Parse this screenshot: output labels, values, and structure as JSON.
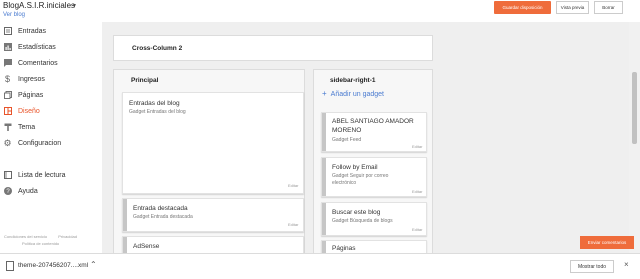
{
  "header": {
    "blog_title": "BlogA.S.I.R.iniciales",
    "view_blog": "Ver blog",
    "save_label": "Guardar disposición",
    "preview_label": "Vista previa",
    "delete_label": "Borrar"
  },
  "sidebar": {
    "items": [
      {
        "label": "Entradas",
        "icon": "posts-icon"
      },
      {
        "label": "Estadísticas",
        "icon": "stats-icon"
      },
      {
        "label": "Comentarios",
        "icon": "comments-icon"
      },
      {
        "label": "Ingresos",
        "icon": "dollar-icon"
      },
      {
        "label": "Páginas",
        "icon": "pages-icon"
      },
      {
        "label": "Diseño",
        "icon": "layout-icon"
      },
      {
        "label": "Tema",
        "icon": "theme-icon"
      },
      {
        "label": "Configuracion",
        "icon": "gear-icon"
      },
      {
        "label": "Lista de lectura",
        "icon": "reading-list-icon"
      },
      {
        "label": "Ayuda",
        "icon": "help-icon"
      }
    ],
    "footer": {
      "terms": "Condiciones del servicio",
      "privacy": "Privacidad",
      "content_policy": "Política de contenido"
    }
  },
  "layout": {
    "cross_column": "Cross-Column 2",
    "principal": {
      "title": "Principal",
      "gadgets": [
        {
          "title": "Entradas del blog",
          "sub": "Gadget Entradas del blog",
          "edit": "Editar"
        },
        {
          "title": "Entrada destacada",
          "sub": "Gadget Entrada destacada",
          "edit": "Editar"
        },
        {
          "title": "AdSense",
          "sub": "",
          "edit": ""
        }
      ]
    },
    "sidebar_right": {
      "title": "sidebar-right-1",
      "add_gadget": "Añadir un gadget",
      "gadgets": [
        {
          "title": "ABEL SANTIAGO AMADOR MORENO",
          "sub": "Gadget Feed",
          "edit": "Editar"
        },
        {
          "title": "Follow by Email",
          "sub": "Gadget Seguir por correo electrónico",
          "edit": "Editar"
        },
        {
          "title": "Buscar este blog",
          "sub": "Gadget Búsqueda de blogs",
          "edit": "Editar"
        },
        {
          "title": "Páginas",
          "sub": "",
          "edit": ""
        }
      ]
    },
    "feedback_label": "Enviar comentarios"
  },
  "downloads": {
    "filename": "theme-207456207....xml",
    "show_all": "Mostrar todo"
  }
}
